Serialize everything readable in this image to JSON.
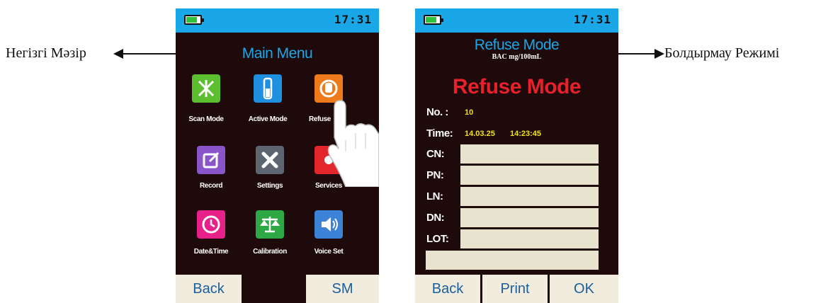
{
  "annotations": {
    "left_label": "Негізгі Мәзір",
    "right_label": "Болдырмау Режимі"
  },
  "left_screen": {
    "status": {
      "time": "17:31",
      "battery_icon": "battery-icon"
    },
    "title": "Main Menu",
    "tiles": [
      {
        "label": "Scan Mode",
        "icon": "scan-icon",
        "color": "#5cbf2f"
      },
      {
        "label": "Active Mode",
        "icon": "tube-icon",
        "color": "#1f8fe0"
      },
      {
        "label": "Refuse",
        "icon": "hand-stop-icon",
        "color": "#ef7a1a"
      },
      {
        "label": "Record",
        "icon": "edit-icon",
        "color": "#8a55c9"
      },
      {
        "label": "Settings",
        "icon": "tools-icon",
        "color": "#5d6670"
      },
      {
        "label": "Services",
        "icon": "services-icon",
        "color": "#e3262b"
      },
      {
        "label": "Date&Time",
        "icon": "clock-icon",
        "color": "#e8208a"
      },
      {
        "label": "Calibration",
        "icon": "scale-icon",
        "color": "#2ea844"
      },
      {
        "label": "Voice Set",
        "icon": "speaker-icon",
        "color": "#3c82d6"
      }
    ],
    "softkeys": {
      "left": "Back",
      "right": "SM"
    }
  },
  "right_screen": {
    "status": {
      "time": "17:31",
      "battery_icon": "battery-icon"
    },
    "title": "Refuse Mode",
    "subtitle": "BAC mg/100mL",
    "big_title": "Refuse Mode",
    "no_label": "No. :",
    "no_value": "10",
    "time_label": "Time:",
    "date_value": "14.03.25",
    "time_value": "14:23:45",
    "fields": [
      {
        "label": "CN:",
        "value": ""
      },
      {
        "label": "PN:",
        "value": ""
      },
      {
        "label": "LN:",
        "value": ""
      },
      {
        "label": "DN:",
        "value": ""
      },
      {
        "label": "LOT:",
        "value": ""
      }
    ],
    "softkeys": {
      "left": "Back",
      "middle": "Print",
      "right": "OK"
    }
  }
}
